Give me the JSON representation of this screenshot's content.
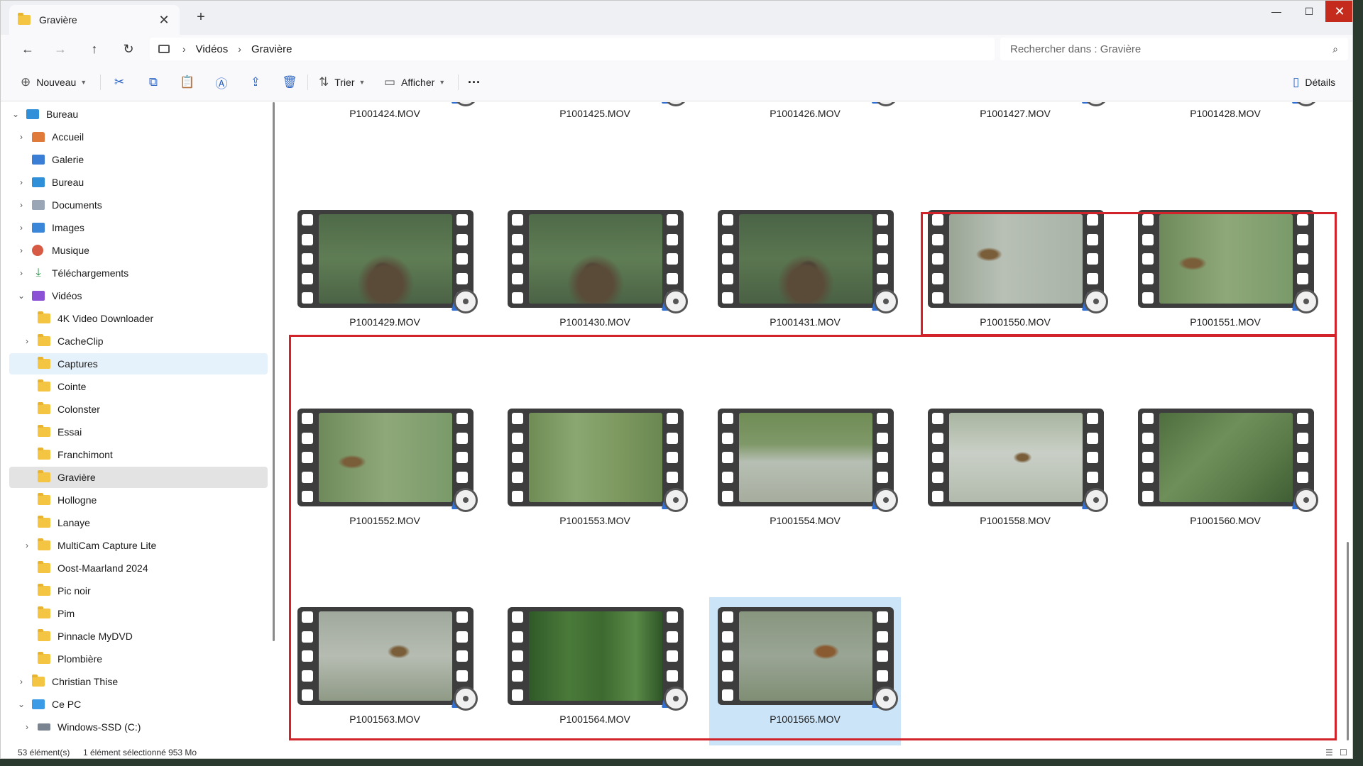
{
  "window": {
    "tab_title": "Gravière",
    "new_tab": "+",
    "close_tab": "✕",
    "minimize": "—",
    "maximize": "☐",
    "close": "✕"
  },
  "nav": {
    "back": "←",
    "forward": "→",
    "up": "↑",
    "refresh": "↻"
  },
  "breadcrumb": {
    "items": [
      "Vidéos",
      "Gravière"
    ],
    "separator": "›"
  },
  "search": {
    "placeholder": "Rechercher dans : Gravière",
    "icon": "⌕"
  },
  "commandbar": {
    "new_label": "Nouveau",
    "sort_label": "Trier",
    "view_label": "Afficher",
    "more_label": "···",
    "details_label": "Détails"
  },
  "sidebar": {
    "items": [
      {
        "label": "Bureau",
        "icon": "desktop-icon",
        "expanded": true
      },
      {
        "label": "Accueil",
        "icon": "home-icon"
      },
      {
        "label": "Galerie",
        "icon": "gallery-icon"
      },
      {
        "label": "Bureau",
        "icon": "desktop-icon"
      },
      {
        "label": "Documents",
        "icon": "documents-icon"
      },
      {
        "label": "Images",
        "icon": "images-icon"
      },
      {
        "label": "Musique",
        "icon": "music-icon"
      },
      {
        "label": "Téléchargements",
        "icon": "downloads-icon"
      },
      {
        "label": "Vidéos",
        "icon": "videos-icon",
        "expanded": true
      },
      {
        "label": "4K Video Downloader",
        "icon": "folder-icon"
      },
      {
        "label": "CacheClip",
        "icon": "folder-icon"
      },
      {
        "label": "Captures",
        "icon": "folder-icon"
      },
      {
        "label": "Cointe",
        "icon": "folder-icon"
      },
      {
        "label": "Colonster",
        "icon": "folder-icon"
      },
      {
        "label": "Essai",
        "icon": "folder-icon"
      },
      {
        "label": "Franchimont",
        "icon": "folder-icon"
      },
      {
        "label": "Gravière",
        "icon": "folder-icon",
        "active": true
      },
      {
        "label": "Hollogne",
        "icon": "folder-icon"
      },
      {
        "label": "Lanaye",
        "icon": "folder-icon"
      },
      {
        "label": "MultiCam Capture Lite",
        "icon": "folder-icon"
      },
      {
        "label": "Oost-Maarland 2024",
        "icon": "folder-icon"
      },
      {
        "label": "Pic noir",
        "icon": "folder-icon"
      },
      {
        "label": "Pim",
        "icon": "folder-icon"
      },
      {
        "label": "Pinnacle MyDVD",
        "icon": "folder-icon"
      },
      {
        "label": "Plombière",
        "icon": "folder-icon"
      },
      {
        "label": "Christian Thise",
        "icon": "folder-icon"
      },
      {
        "label": "Ce PC",
        "icon": "pc-icon",
        "expanded": true
      },
      {
        "label": "Windows-SSD (C:)",
        "icon": "drive-icon"
      }
    ]
  },
  "files": {
    "row1": [
      "P1001424.MOV",
      "P1001425.MOV",
      "P1001426.MOV",
      "P1001427.MOV",
      "P1001428.MOV"
    ],
    "row2": [
      "P1001429.MOV",
      "P1001430.MOV",
      "P1001431.MOV",
      "P1001550.MOV",
      "P1001551.MOV"
    ],
    "row3": [
      "P1001552.MOV",
      "P1001553.MOV",
      "P1001554.MOV",
      "P1001558.MOV",
      "P1001560.MOV"
    ],
    "row4": [
      "P1001563.MOV",
      "P1001564.MOV",
      "P1001565.MOV"
    ]
  },
  "status": {
    "count": "53 élément(s)",
    "selection": "1 élément sélectionné  953 Mo"
  },
  "colors": {
    "highlight": "#d2232a",
    "selection": "#cce4f7",
    "folder": "#f4c542"
  }
}
